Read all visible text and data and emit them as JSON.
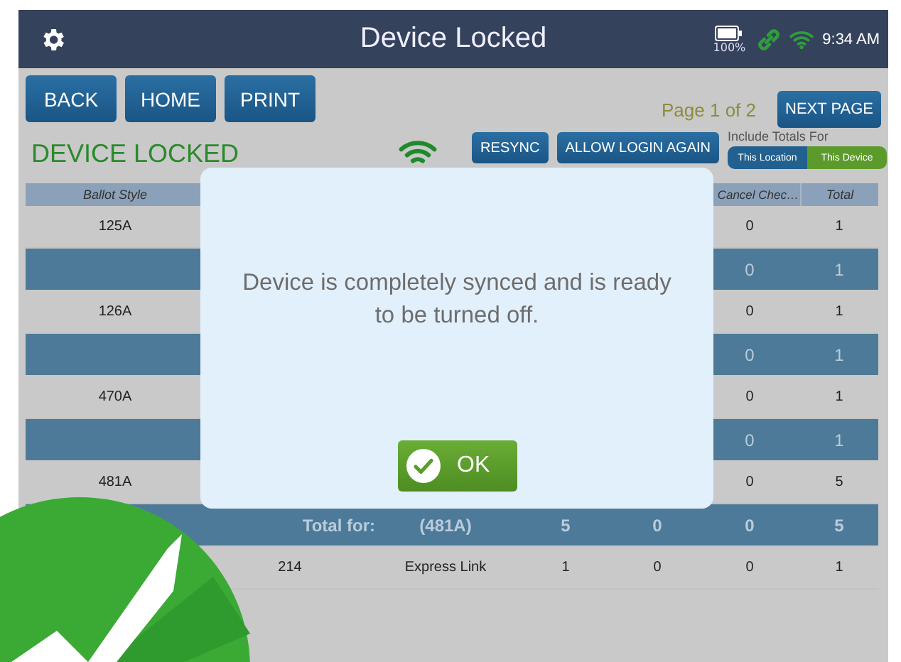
{
  "header": {
    "title": "Device Locked",
    "battery": "100%",
    "time": "9:34 AM"
  },
  "toolbar": {
    "buttons": [
      "BACK",
      "HOME",
      "PRINT"
    ],
    "page": "Page 1 of 2",
    "next": "NEXT PAGE"
  },
  "status": {
    "title": "DEVICE LOCKED",
    "actions": [
      "RESYNC",
      "ALLOW LOGIN AGAIN"
    ],
    "totals_label": "Include Totals For",
    "segments": [
      {
        "label": "This Location",
        "selected": false
      },
      {
        "label": "This Device",
        "selected": true
      }
    ]
  },
  "table": {
    "columns": [
      "Ballot Style",
      null,
      null,
      null,
      null,
      "Cancel Chec…",
      "Total"
    ],
    "rows": [
      {
        "kind": "item",
        "cells": [
          "125A",
          null,
          null,
          null,
          null,
          "0",
          "1"
        ]
      },
      {
        "kind": "subtotal",
        "cells": [
          null,
          null,
          null,
          null,
          null,
          "0",
          "1"
        ]
      },
      {
        "kind": "item",
        "cells": [
          "126A",
          null,
          null,
          null,
          null,
          "0",
          "1"
        ]
      },
      {
        "kind": "subtotal",
        "cells": [
          null,
          null,
          null,
          null,
          null,
          "0",
          "1"
        ]
      },
      {
        "kind": "item",
        "cells": [
          "470A",
          null,
          null,
          null,
          null,
          "0",
          "1"
        ]
      },
      {
        "kind": "subtotal",
        "cells": [
          null,
          null,
          null,
          null,
          null,
          "0",
          "1"
        ]
      },
      {
        "kind": "item",
        "cells": [
          "481A",
          null,
          null,
          null,
          null,
          "0",
          "5"
        ]
      },
      {
        "kind": "total",
        "cells": [
          null,
          "Total for:",
          "(481A)",
          "5",
          "0",
          "0",
          "5"
        ]
      },
      {
        "kind": "item",
        "cells": [
          null,
          "214",
          "Express Link",
          "1",
          "0",
          "0",
          "1"
        ]
      }
    ]
  },
  "dialog": {
    "message": "Device is completely synced and is ready to be turned off.",
    "button": "OK"
  }
}
